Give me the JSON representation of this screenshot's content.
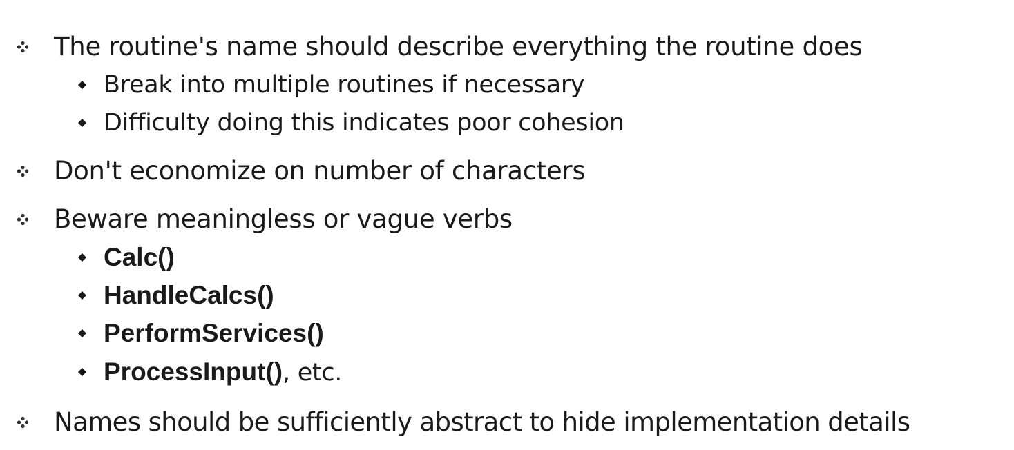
{
  "items": [
    {
      "text": "The routine's name should describe everything the routine does",
      "sub": [
        {
          "text": "Break into multiple routines if necessary"
        },
        {
          "text": "Difficulty doing this indicates poor cohesion"
        }
      ]
    },
    {
      "text": "Don't economize on number of characters"
    },
    {
      "text": "Beware meaningless or vague verbs",
      "sub": [
        {
          "code": "Calc()"
        },
        {
          "code": "HandleCalcs()"
        },
        {
          "code": "PerformServices()"
        },
        {
          "code": "ProcessInput()",
          "suffix": ", etc."
        }
      ]
    },
    {
      "text": "Names should be sufficiently abstract to hide implementation details"
    }
  ]
}
